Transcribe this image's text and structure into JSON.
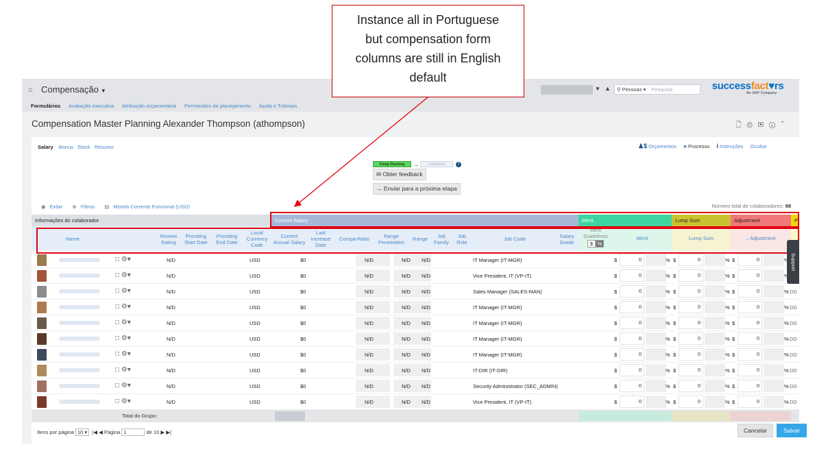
{
  "callout": {
    "lines": [
      "Instance all in Portuguese",
      "but compensation form",
      "columns are still in English",
      "default"
    ]
  },
  "topbar": {
    "module": "Compensação",
    "subnav": [
      "Formulários",
      "Avaliação executiva",
      "Atribuição orçamentária",
      "Permissões de planejamento",
      "Ajuda e Tutoriais"
    ],
    "search_scope": "Pessoas",
    "search_placeholder": "Pesquisa",
    "logo": "successfactors",
    "logo_sub": "An SAP Company"
  },
  "page_title": "Compensation Master Planning Alexander Thompson (athompson)",
  "tabs": [
    "Salary",
    "Bonus",
    "Stock",
    "Resumo"
  ],
  "right_tools": {
    "budgets": "Orçamentos",
    "process": "Processo",
    "instructions": "Instruções",
    "hide": "Ocultar"
  },
  "process": {
    "stage_current": "Comp Planning",
    "stage_next": "Completed",
    "feedback_button": "Obter feedback",
    "next_step_button": "Enviar para a próxima etapa"
  },
  "filters": {
    "show": "Exibir",
    "filters": "Filtros",
    "currency": "Moeda Corrente Funcional (USD)"
  },
  "total_employees": {
    "label": "Número total de colaboradores:",
    "value": "98"
  },
  "groups": {
    "employee_info": "Informações do colaborador",
    "current_salary": "Current Salary",
    "merit": "Merit",
    "lump_sum": "Lump Sum",
    "adjustment": "Adjustment",
    "cut": "P"
  },
  "columns": {
    "name": "Name",
    "review_rating": "Review|Rating",
    "prorating_start": "Prorating|Start Date",
    "prorating_end": "Prorating|End Date",
    "local_currency": "Local|Currency|Code",
    "current_salary": "Current|Annual Salary",
    "last_increase": "Last|Increase|Date",
    "compa_ratio": "Compa-Ratio",
    "range_penetration": "Range|Penetration",
    "range": "Range",
    "job_family": "Job|Family",
    "job_role": "Job|Role",
    "job_code": "Job Code",
    "salary_grade": "Salary|Grade",
    "merit_guidelines": "Merit|Guidelines",
    "merit_guidelines_toggle": [
      "$",
      "%"
    ],
    "merit": "Merit",
    "lump_sum": "Lump Sum",
    "adjustment": "Adjustment"
  },
  "rows": [
    {
      "avatar": "#9b7a4e",
      "rating": "N/D",
      "currency": "USD",
      "salary": "$0",
      "compa": "N/D",
      "penetration": "N/D",
      "range": "N/D",
      "job_code": "IT Manager (IT-MGR)",
      "merit": "0",
      "lump": "0",
      "adj": "0",
      "dd": ""
    },
    {
      "avatar": "#a0553c",
      "rating": "N/D",
      "currency": "USD",
      "salary": "$0",
      "compa": "N/D",
      "penetration": "N/D",
      "range": "N/D",
      "job_code": "Vice President, IT (VP-IT)",
      "merit": "0",
      "lump": "0",
      "adj": "0",
      "dd": ""
    },
    {
      "avatar": "#8c8c8c",
      "rating": "N/D",
      "currency": "USD",
      "salary": "$0",
      "compa": "N/D",
      "penetration": "N/D",
      "range": "N/D",
      "job_code": "Sales Manager (SALES-MAN)",
      "merit": "0",
      "lump": "0",
      "adj": "0",
      "dd": "DD"
    },
    {
      "avatar": "#b07a50",
      "rating": "N/D",
      "currency": "USD",
      "salary": "$0",
      "compa": "N/D",
      "penetration": "N/D",
      "range": "N/D",
      "job_code": "IT Manager (IT-MGR)",
      "merit": "0",
      "lump": "0",
      "adj": "0",
      "dd": "DD"
    },
    {
      "avatar": "#6a5a4a",
      "rating": "N/D",
      "currency": "USD",
      "salary": "$0",
      "compa": "N/D",
      "penetration": "N/D",
      "range": "N/D",
      "job_code": "IT Manager (IT-MGR)",
      "merit": "0",
      "lump": "0",
      "adj": "0",
      "dd": "DD"
    },
    {
      "avatar": "#5a3a2a",
      "rating": "N/D",
      "currency": "USD",
      "salary": "$0",
      "compa": "N/D",
      "penetration": "N/D",
      "range": "N/D",
      "job_code": "IT Manager (IT-MGR)",
      "merit": "0",
      "lump": "0",
      "adj": "0",
      "dd": "DD"
    },
    {
      "avatar": "#3f4a5a",
      "rating": "N/D",
      "currency": "USD",
      "salary": "$0",
      "compa": "N/D",
      "penetration": "N/D",
      "range": "N/D",
      "job_code": "IT Manager (IT-MGR)",
      "merit": "0",
      "lump": "0",
      "adj": "0",
      "dd": "DD"
    },
    {
      "avatar": "#b08a5a",
      "rating": "N/D",
      "currency": "USD",
      "salary": "$0",
      "compa": "N/D",
      "penetration": "N/D",
      "range": "N/D",
      "job_code": "IT-DIR (IT-DIR)",
      "merit": "0",
      "lump": "0",
      "adj": "0",
      "dd": "DD"
    },
    {
      "avatar": "#a07060",
      "rating": "N/D",
      "currency": "USD",
      "salary": "$0",
      "compa": "N/D",
      "penetration": "N/D",
      "range": "N/D",
      "job_code": "Security Administrator (SEC_ADMIN)",
      "merit": "0",
      "lump": "0",
      "adj": "0",
      "dd": "DD"
    },
    {
      "avatar": "#7a3a2a",
      "rating": "N/D",
      "currency": "USD",
      "salary": "$0",
      "compa": "N/D",
      "penetration": "N/D",
      "range": "N/D",
      "job_code": "Vice President, IT (VP-IT)",
      "merit": "0",
      "lump": "0",
      "adj": "0",
      "dd": "DD"
    }
  ],
  "group_total": "Total do Grupo:",
  "footer": {
    "per_page": "Itens por página",
    "per_page_value": "10",
    "page_label": "Página",
    "page_value": "1",
    "of_pages": "de 10",
    "cancel": "Cancelar",
    "save": "Salvar"
  },
  "support": "Support",
  "colors": {
    "merit_header": "#3dd6a0",
    "lump_header": "#c8c430",
    "adjust_header": "#f07878",
    "salary_header": "#a6b8d8",
    "save": "#35a6e8",
    "callout_border": "#c00000"
  }
}
